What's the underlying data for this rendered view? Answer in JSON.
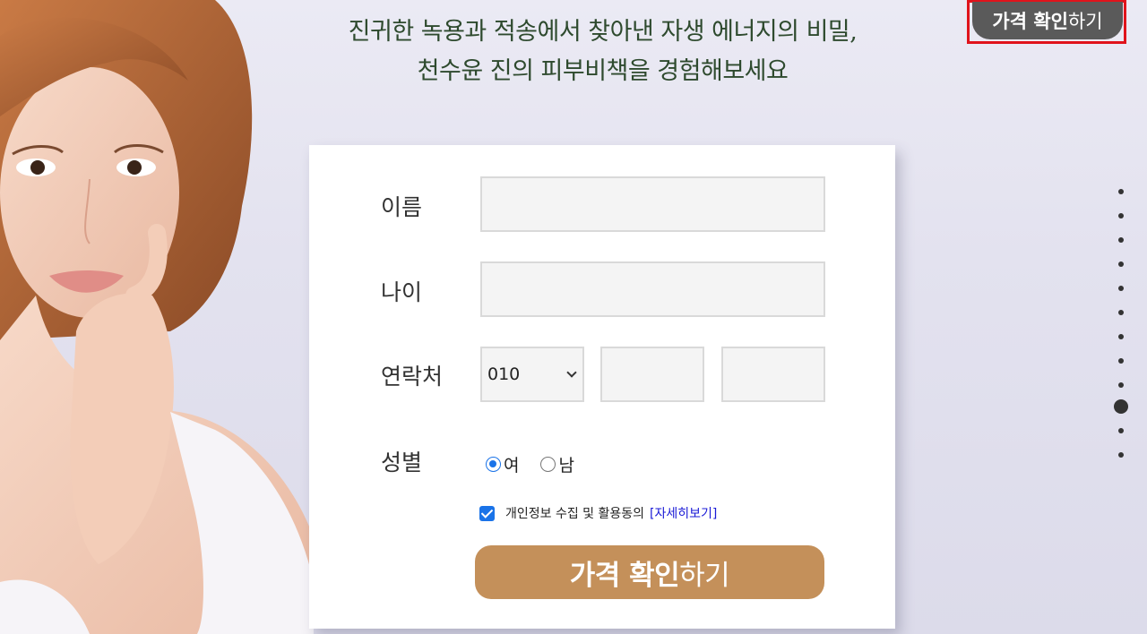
{
  "headline": {
    "line1": "진귀한 녹용과 적송에서 찾아낸 자생 에너지의 비밀,",
    "line2": "천수윤 진의 피부비책을 경험해보세요"
  },
  "top_cta": {
    "bold": "가격 확인",
    "light": "하기"
  },
  "form": {
    "name_label": "이름",
    "age_label": "나이",
    "contact_label": "연락처",
    "phone_prefix": "010",
    "gender_label": "성별",
    "gender_options": [
      {
        "label": "여",
        "checked": true
      },
      {
        "label": "남",
        "checked": false
      }
    ],
    "consent_text": "개인정보 수집 및 활용동의",
    "consent_link": "[자세히보기]",
    "consent_checked": true,
    "submit": {
      "bold": "가격 확인",
      "light": "하기"
    }
  },
  "pager": {
    "count": 11,
    "active_index": 9
  },
  "colors": {
    "accent_button": "#c4905a",
    "top_cta_bg": "#5a5a5a",
    "headline": "#2e4a2e",
    "highlight_frame": "#e0131b",
    "link": "#1a1ad6"
  }
}
